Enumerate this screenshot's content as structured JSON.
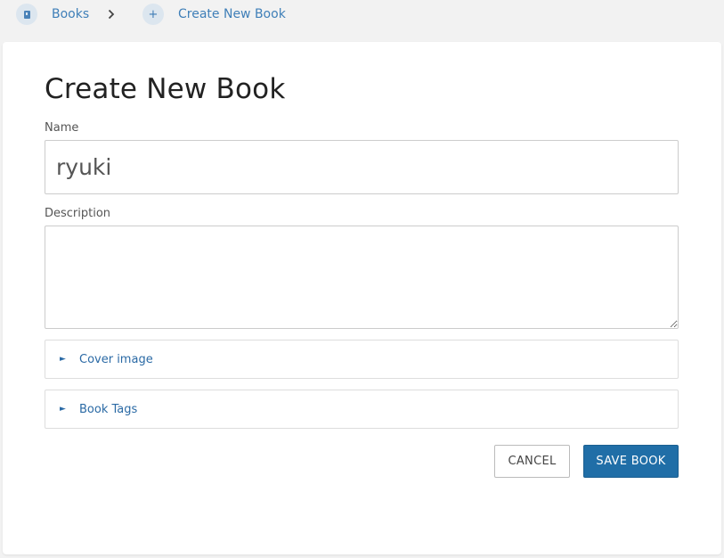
{
  "breadcrumb": {
    "items": [
      {
        "label": "Books",
        "icon": "book-icon"
      },
      {
        "label": "Create New Book",
        "icon": "plus-icon"
      }
    ],
    "separator_icon": "chevron-right-icon"
  },
  "page": {
    "title": "Create New Book"
  },
  "form": {
    "name": {
      "label": "Name",
      "value": "ryuki",
      "placeholder": ""
    },
    "description": {
      "label": "Description",
      "value": "",
      "placeholder": ""
    },
    "sections": [
      {
        "label": "Cover image",
        "icon": "triangle-right-icon"
      },
      {
        "label": "Book Tags",
        "icon": "triangle-right-icon"
      }
    ],
    "toggle_glyph": "►"
  },
  "actions": {
    "cancel_label": "CANCEL",
    "save_label": "SAVE BOOK"
  },
  "colors": {
    "accent": "#206ea7",
    "link": "#3f7fb8",
    "background": "#f2f2f2"
  }
}
